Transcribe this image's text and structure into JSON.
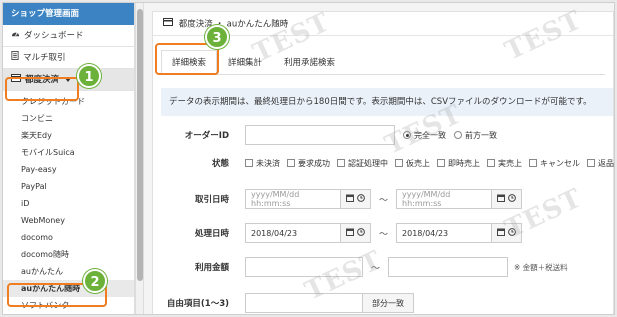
{
  "sidebar": {
    "header": "ショップ管理画面",
    "items": [
      {
        "icon": "dashboard-icon",
        "label": "ダッシュボード"
      },
      {
        "icon": "document-icon",
        "label": "マルチ取引"
      },
      {
        "icon": "card-icon",
        "label": "都度決済"
      }
    ],
    "subitems": [
      "クレジットカード",
      "コンビニ",
      "楽天Edy",
      "モバイルSuica",
      "Pay-easy",
      "PayPal",
      "iD",
      "WebMoney",
      "docomo",
      "docomo随時",
      "auかんたん",
      "auかんたん随時",
      "ソフトバンク"
    ],
    "selected_subitem": "auかんたん随時"
  },
  "main": {
    "breadcrumb": "都度決済 ・ auかんたん随時",
    "tabs": [
      "詳細検索",
      "詳細集計",
      "利用承諾検索"
    ],
    "notice": "データの表示期間は、最終処理日から180日間です。表示期間中は、CSVファイルのダウンロードが可能です。",
    "order_id": {
      "label": "オーダーID",
      "value": "",
      "match_options": [
        "完全一致",
        "前方一致"
      ],
      "selected": "完全一致"
    },
    "status": {
      "label": "状態",
      "options": [
        "未決済",
        "要求成功",
        "認証処理中",
        "仮売上",
        "即時売上",
        "実売上",
        "キャンセル",
        "返品"
      ]
    },
    "trade_date": {
      "label": "取引日時",
      "from_placeholder": "yyyy/MM/dd hh:mm:ss",
      "to_placeholder": "yyyy/MM/dd hh:mm:ss",
      "separator": "〜"
    },
    "process_date": {
      "label": "処理日時",
      "from_value": "2018/04/23",
      "to_value": "2018/04/23",
      "separator": "〜"
    },
    "amount": {
      "label": "利用金額",
      "separator": "〜",
      "note": "※ 金額＋税送料"
    },
    "free_item": {
      "label": "自由項目(1〜3)",
      "match_label": "部分一致"
    }
  },
  "annotations": {
    "badges": [
      "1",
      "2",
      "3"
    ],
    "highlight_color": "#ef7d22",
    "badge_color": "#6bb13a"
  },
  "watermark": "TEST",
  "colors": {
    "sidebar_header": "#3b83c2",
    "notice_bg": "#eaf1f8"
  }
}
